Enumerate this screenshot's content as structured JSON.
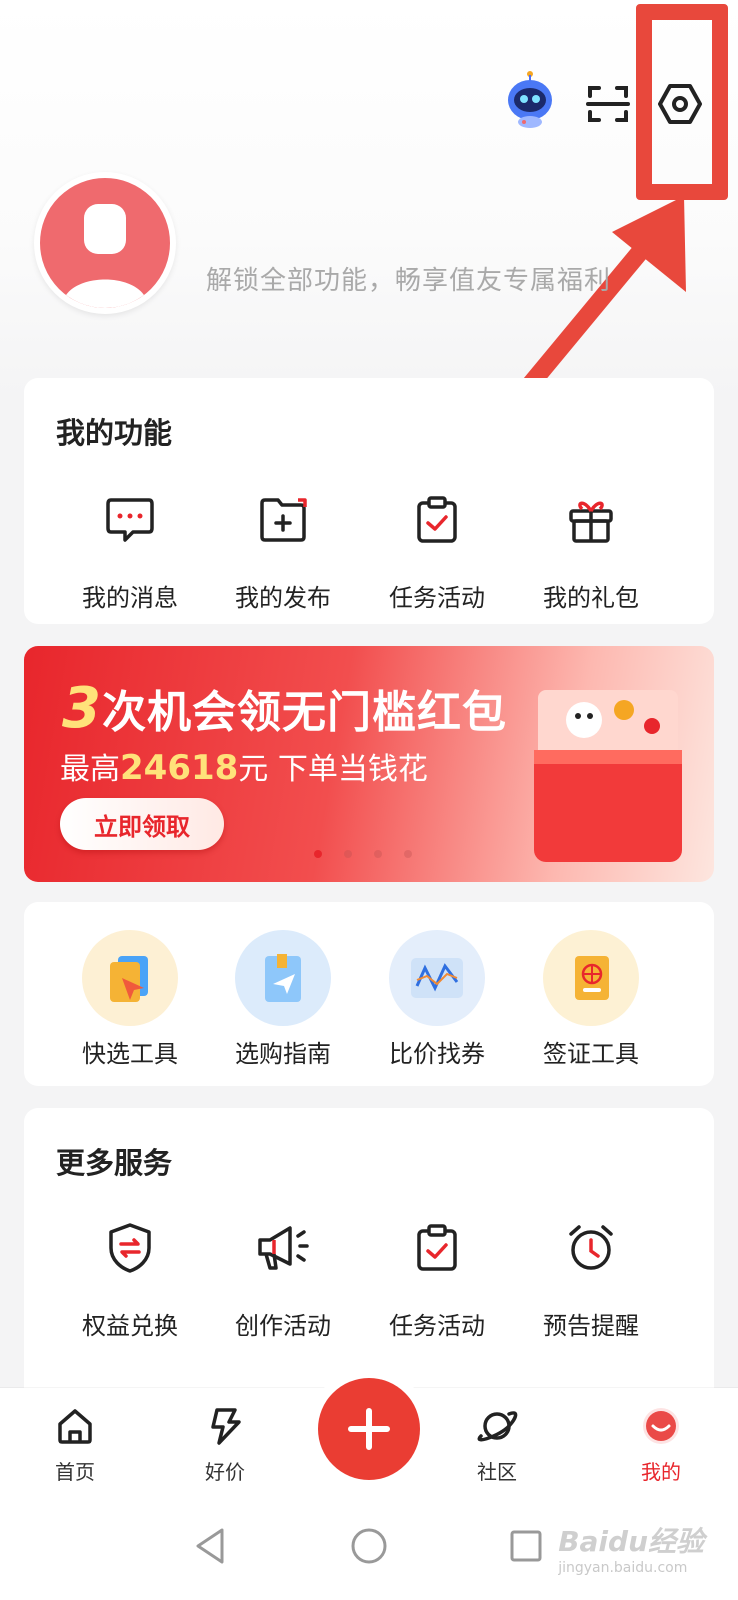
{
  "header": {
    "robot_icon": "robot-assistant-icon",
    "scan_icon": "scan-icon",
    "settings_icon": "settings-gear-icon"
  },
  "profile": {
    "login_tip": "解锁全部功能，畅享值友专属福利"
  },
  "my_features": {
    "title": "我的功能",
    "items": [
      {
        "label": "我的消息",
        "icon": "message-icon"
      },
      {
        "label": "我的发布",
        "icon": "publish-folder-icon"
      },
      {
        "label": "任务活动",
        "icon": "task-clipboard-icon"
      },
      {
        "label": "我的礼包",
        "icon": "gift-icon"
      }
    ]
  },
  "banner": {
    "title_num": "3",
    "title_rest": "次机会领无门槛红包",
    "sub_prefix": "最高",
    "amount": "24618",
    "sub_suffix": "元 下单当钱花",
    "button": "立即领取",
    "page_count": 4,
    "active_page": 0
  },
  "tools": {
    "items": [
      {
        "label": "快选工具",
        "icon": "quick-select-icon"
      },
      {
        "label": "选购指南",
        "icon": "buying-guide-icon"
      },
      {
        "label": "比价找券",
        "icon": "price-compare-icon"
      },
      {
        "label": "签证工具",
        "icon": "visa-passport-icon"
      }
    ]
  },
  "more_services": {
    "title": "更多服务",
    "items": [
      {
        "label": "权益兑换",
        "icon": "shield-exchange-icon"
      },
      {
        "label": "创作活动",
        "icon": "megaphone-icon"
      },
      {
        "label": "任务活动",
        "icon": "task-clipboard-icon"
      },
      {
        "label": "预告提醒",
        "icon": "alarm-clock-icon"
      }
    ]
  },
  "bottom_nav": {
    "items": [
      {
        "label": "首页",
        "icon": "home-icon"
      },
      {
        "label": "好价",
        "icon": "lightning-icon"
      },
      {
        "label": "社区",
        "icon": "planet-icon"
      },
      {
        "label": "我的",
        "icon": "profile-icon"
      }
    ],
    "fab_icon": "plus-icon"
  },
  "watermark": {
    "brand": "Baidu经验",
    "url": "jingyan.baidu.com"
  },
  "colors": {
    "accent": "#e8262c",
    "highlight": "#e8483c",
    "avatar": "#ef6a6e"
  }
}
